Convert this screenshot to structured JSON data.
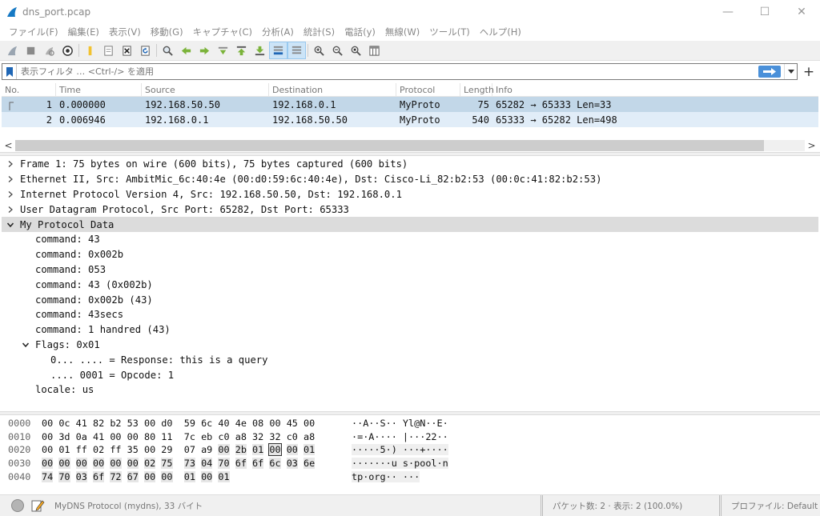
{
  "window": {
    "title": "dns_port.pcap",
    "minimize": "—",
    "maximize": "☐",
    "close": "✕"
  },
  "menu": [
    "ファイル(F)",
    "編集(E)",
    "表示(V)",
    "移動(G)",
    "キャプチャ(C)",
    "分析(A)",
    "統計(S)",
    "電話(y)",
    "無線(W)",
    "ツール(T)",
    "ヘルプ(H)"
  ],
  "filter": {
    "placeholder": "表示フィルタ … <Ctrl-/> を適用",
    "add": "+"
  },
  "packet_list": {
    "columns": [
      "No.",
      "Time",
      "Source",
      "Destination",
      "Protocol",
      "Length",
      "Info"
    ],
    "rows": [
      {
        "no": "1",
        "time": "0.000000",
        "source": "192.168.50.50",
        "destination": "192.168.0.1",
        "protocol": "MyProto",
        "length": "75",
        "info": "65282 → 65333 Len=33"
      },
      {
        "no": "2",
        "time": "0.006946",
        "source": "192.168.0.1",
        "destination": "192.168.50.50",
        "protocol": "MyProto",
        "length": "540",
        "info": "65333 → 65282 Len=498"
      }
    ]
  },
  "scroll": {
    "left": "<",
    "right": ">"
  },
  "details": [
    {
      "text": "Frame 1: 75 bytes on wire (600 bits), 75 bytes captured (600 bits)",
      "level": 0,
      "toggle": "collapsed"
    },
    {
      "text": "Ethernet II, Src: AmbitMic_6c:40:4e (00:d0:59:6c:40:4e), Dst: Cisco-Li_82:b2:53 (00:0c:41:82:b2:53)",
      "level": 0,
      "toggle": "collapsed"
    },
    {
      "text": "Internet Protocol Version 4, Src: 192.168.50.50, Dst: 192.168.0.1",
      "level": 0,
      "toggle": "collapsed"
    },
    {
      "text": "User Datagram Protocol, Src Port: 65282, Dst Port: 65333",
      "level": 0,
      "toggle": "collapsed"
    },
    {
      "text": "My Protocol Data",
      "level": 0,
      "toggle": "expanded",
      "selected": true
    },
    {
      "text": "command: 43",
      "level": 1,
      "toggle": "none"
    },
    {
      "text": "command: 0x002b",
      "level": 1,
      "toggle": "none"
    },
    {
      "text": "command: 053",
      "level": 1,
      "toggle": "none"
    },
    {
      "text": "command: 43 (0x002b)",
      "level": 1,
      "toggle": "none"
    },
    {
      "text": "command: 0x002b (43)",
      "level": 1,
      "toggle": "none"
    },
    {
      "text": "command: 43secs",
      "level": 1,
      "toggle": "none"
    },
    {
      "text": "command: 1 handred (43)",
      "level": 1,
      "toggle": "none"
    },
    {
      "text": "Flags: 0x01",
      "level": 1,
      "toggle": "expanded"
    },
    {
      "text": "0... .... = Response: this is a query",
      "level": 2,
      "toggle": "none"
    },
    {
      "text": ".... 0001 = Opcode: 1",
      "level": 2,
      "toggle": "none"
    },
    {
      "text": "locale: us",
      "level": 1,
      "toggle": "none"
    }
  ],
  "bytes": [
    {
      "offset": "0000",
      "hex": [
        "00",
        "0c",
        "41",
        "82",
        "b2",
        "53",
        "00",
        "d0",
        "59",
        "6c",
        "40",
        "4e",
        "08",
        "00",
        "45",
        "00"
      ],
      "ascii": "··A··S·· Yl@N··E·"
    },
    {
      "offset": "0010",
      "hex": [
        "00",
        "3d",
        "0a",
        "41",
        "00",
        "00",
        "80",
        "11",
        "7c",
        "eb",
        "c0",
        "a8",
        "32",
        "32",
        "c0",
        "a8"
      ],
      "ascii": "·=·A···· |···22··"
    },
    {
      "offset": "0020",
      "hex": [
        "00",
        "01",
        "ff",
        "02",
        "ff",
        "35",
        "00",
        "29",
        "07",
        "a9",
        "00",
        "2b",
        "01",
        "00",
        "00",
        "01"
      ],
      "ascii": "·····5·) ···+····"
    },
    {
      "offset": "0030",
      "hex": [
        "00",
        "00",
        "00",
        "00",
        "00",
        "00",
        "02",
        "75",
        "73",
        "04",
        "70",
        "6f",
        "6f",
        "6c",
        "03",
        "6e"
      ],
      "ascii": "·······u s·pool·n"
    },
    {
      "offset": "0040",
      "hex": [
        "74",
        "70",
        "03",
        "6f",
        "72",
        "67",
        "00",
        "00",
        "01",
        "00",
        "01"
      ],
      "ascii": "tp·org·· ···"
    }
  ],
  "status": {
    "info": "MyDNS Protocol (mydns), 33 バイト",
    "packets": "パケット数: 2 · 表示: 2 (100.0%)",
    "profile": "プロファイル: Default"
  }
}
